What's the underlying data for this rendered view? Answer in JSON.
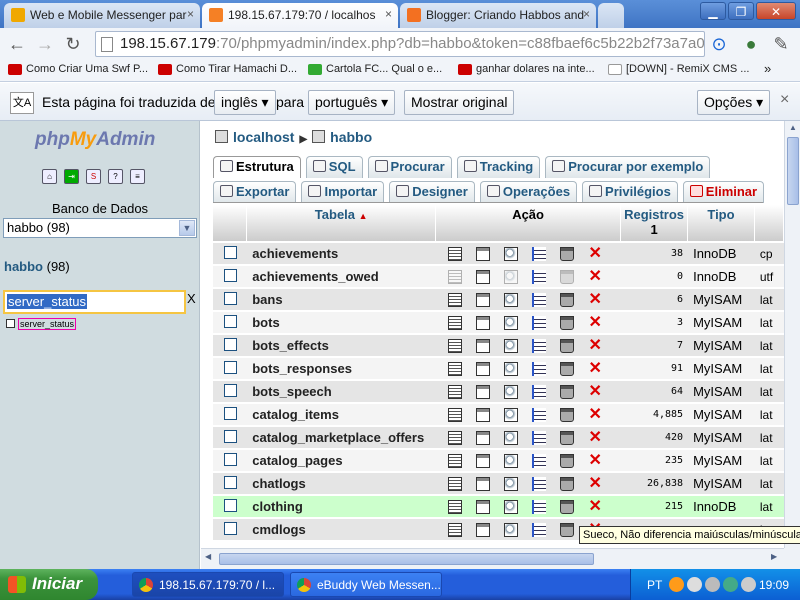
{
  "browser": {
    "tabs": [
      {
        "title": "Web e Mobile Messenger par",
        "close": "×",
        "color": "#f0a800"
      },
      {
        "title": "198.15.67.179:70 / localhos",
        "close": "×",
        "color": "#f58025"
      },
      {
        "title": "Blogger: Criando Habbos and",
        "close": "×",
        "color": "#f37021"
      }
    ],
    "url_host": "198.15.67.179",
    "url_rest": ":70/phpmyadmin/index.php?db=habbo&token=c88fbaef6c5b22b2f73a7a0",
    "bookmarks": [
      {
        "label": "Como Criar Uma Swf P...",
        "color": "#cc0000"
      },
      {
        "label": "Como Tirar Hamachi D...",
        "color": "#cc0000"
      },
      {
        "label": "Cartola FC... Qual o e...",
        "color": "#33aa33"
      },
      {
        "label": "ganhar dolares na inte...",
        "color": "#cc0000"
      },
      {
        "label": "[DOWN] - RemiX CMS ...",
        "color": "#ffffff"
      }
    ],
    "more_bookmarks": "»"
  },
  "translate": {
    "prefix": "Esta página foi traduzida de",
    "from_lang": "inglês",
    "to_word": "para",
    "to_lang": "português",
    "show_original": "Mostrar original",
    "options": "Opções",
    "close": "×"
  },
  "sidebar": {
    "logo_php": "php",
    "logo_my": "My",
    "logo_admin": "Admin",
    "db_label": "Banco de Dados",
    "db_select": "habbo (98)",
    "db_name": "habbo",
    "db_count": "(98)",
    "filter_value": "server_status",
    "filter_clear": "X",
    "filter_result": "server_status",
    "quick_icons": [
      "home-icon",
      "exit-icon",
      "sql-icon",
      "help-icon",
      "docs-icon"
    ]
  },
  "breadcrumb": {
    "server": "localhost",
    "database": "habbo"
  },
  "nav_tabs_row1": [
    {
      "label": "Estrutura",
      "active": true
    },
    {
      "label": "SQL"
    },
    {
      "label": "Procurar"
    },
    {
      "label": "Tracking"
    },
    {
      "label": "Procurar por exemplo"
    }
  ],
  "nav_tabs_row2": [
    {
      "label": "Exportar"
    },
    {
      "label": "Importar"
    },
    {
      "label": "Designer"
    },
    {
      "label": "Operações"
    },
    {
      "label": "Privilégios"
    },
    {
      "label": "Eliminar",
      "danger": true
    }
  ],
  "table": {
    "headers": {
      "name": "Tabela",
      "sort": "▲",
      "action": "Ação",
      "records": "Registros",
      "records_sub": "1",
      "type": "Tipo"
    },
    "rows": [
      {
        "name": "achievements",
        "records": "38",
        "type": "InnoDB",
        "collation": "cp"
      },
      {
        "name": "achievements_owed",
        "records": "0",
        "type": "InnoDB",
        "collation": "utf",
        "empty": true
      },
      {
        "name": "bans",
        "records": "6",
        "type": "MyISAM",
        "collation": "lat"
      },
      {
        "name": "bots",
        "records": "3",
        "type": "MyISAM",
        "collation": "lat"
      },
      {
        "name": "bots_effects",
        "records": "7",
        "type": "MyISAM",
        "collation": "lat"
      },
      {
        "name": "bots_responses",
        "records": "91",
        "type": "MyISAM",
        "collation": "lat"
      },
      {
        "name": "bots_speech",
        "records": "64",
        "type": "MyISAM",
        "collation": "lat"
      },
      {
        "name": "catalog_items",
        "records": "4,885",
        "type": "MyISAM",
        "collation": "lat"
      },
      {
        "name": "catalog_marketplace_offers",
        "records": "420",
        "type": "MyISAM",
        "collation": "lat"
      },
      {
        "name": "catalog_pages",
        "records": "235",
        "type": "MyISAM",
        "collation": "lat"
      },
      {
        "name": "chatlogs",
        "records": "26,838",
        "type": "MyISAM",
        "collation": "lat"
      },
      {
        "name": "clothing",
        "records": "215",
        "type": "InnoDB",
        "collation": "lat",
        "highlight": true
      },
      {
        "name": "cmdlogs",
        "records": "",
        "type": "",
        "collation": "lat"
      }
    ]
  },
  "tooltip": "Sueco, Não diferencia maiúsculas/minúsculas",
  "taskbar": {
    "start": "Iniciar",
    "tasks": [
      {
        "label": "198.15.67.179:70 / l..."
      },
      {
        "label": "eBuddy Web Messen..."
      }
    ],
    "lang": "PT",
    "clock": "19:09"
  }
}
